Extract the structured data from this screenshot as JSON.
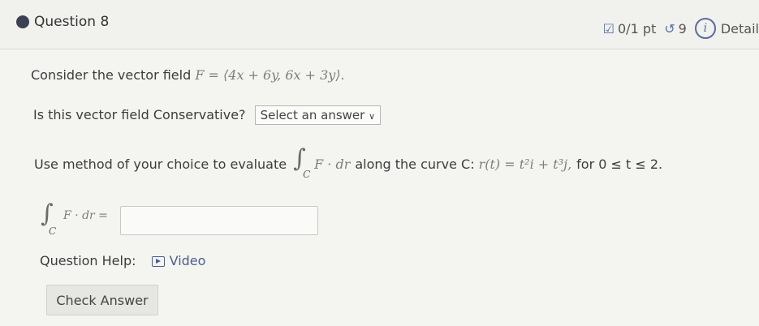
{
  "header": {
    "title": "Question 8",
    "score": "0/1 pt",
    "attempts": "9",
    "details": "Detail"
  },
  "question": {
    "intro_text": "Consider the vector field",
    "field_expr": "F = ⟨4x + 6y, 6x + 3y⟩.",
    "conservative_prompt": "Is this vector field Conservative?",
    "select_value": "Select an answer",
    "evaluate_prompt": "Use method of your choice to evaluate",
    "integral_expr": "F · dr",
    "curve_text": "along the curve C:",
    "curve_expr": "r(t) = t²i + t³j,",
    "range_text": "for 0 ≤ t ≤ 2.",
    "answer_label": "F · dr =",
    "answer_value": "",
    "subscript": "C"
  },
  "help": {
    "label": "Question Help:",
    "video_label": "Video"
  },
  "actions": {
    "check_label": "Check Answer"
  }
}
